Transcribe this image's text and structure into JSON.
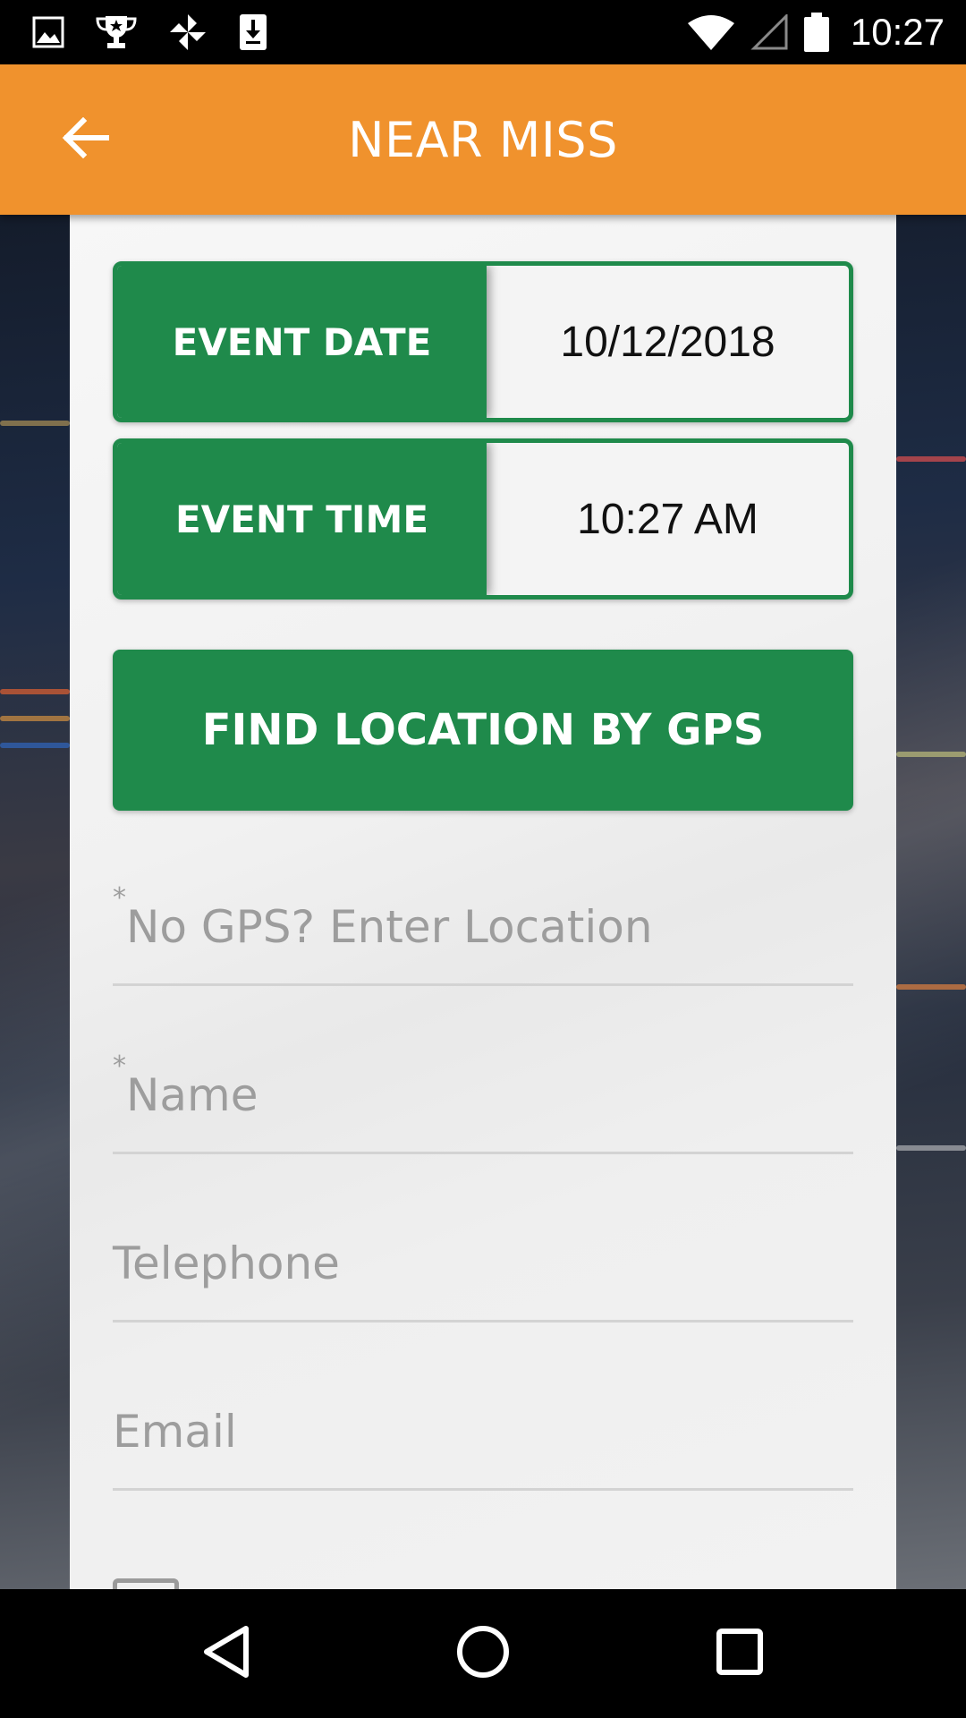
{
  "status_bar": {
    "time": "10:27",
    "icons": [
      "image-icon",
      "trophy-icon",
      "pinwheel-icon",
      "download-icon",
      "wifi-icon",
      "signal-icon",
      "battery-icon"
    ]
  },
  "app_bar": {
    "title": "NEAR MISS",
    "back_icon": "arrow-left-icon",
    "color": "#f0922d"
  },
  "form": {
    "event_date": {
      "label": "EVENT DATE",
      "value": "10/12/2018"
    },
    "event_time": {
      "label": "EVENT TIME",
      "value": "10:27 AM"
    },
    "gps_button": {
      "label": "FIND LOCATION BY GPS"
    },
    "location": {
      "required": "*",
      "placeholder": "No GPS? Enter Location"
    },
    "name": {
      "required": "*",
      "placeholder": "Name"
    },
    "telephone": {
      "placeholder": "Telephone"
    },
    "email": {
      "placeholder": "Email"
    },
    "accent_color": "#1f8a4b"
  },
  "nav_bar": {
    "icons": [
      "back-triangle-icon",
      "home-circle-icon",
      "recents-square-icon"
    ]
  }
}
